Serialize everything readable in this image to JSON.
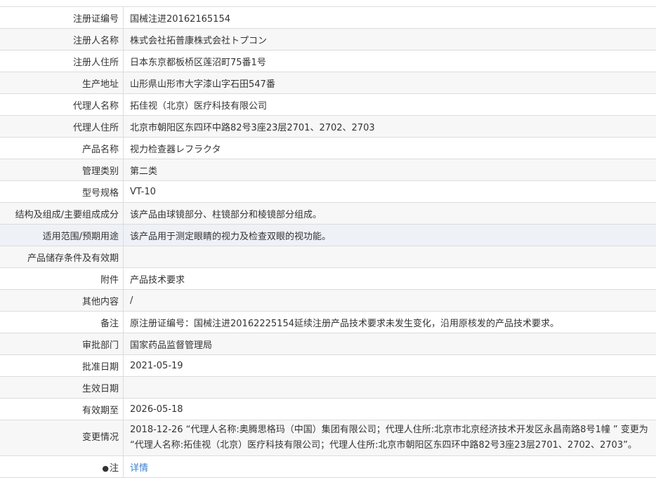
{
  "rows": [
    {
      "label": "注册证编号",
      "value": "国械注进20162165154"
    },
    {
      "label": "注册人名称",
      "value": "株式会社拓普康株式会社トプコン"
    },
    {
      "label": "注册人住所",
      "value": "日本东京都板桥区莲沼町75番1号"
    },
    {
      "label": "生产地址",
      "value": "山形県山形市大字漆山字石田547番"
    },
    {
      "label": "代理人名称",
      "value": "拓佳视（北京）医疗科技有限公司"
    },
    {
      "label": "代理人住所",
      "value": "北京市朝阳区东四环中路82号3座23层2701、2702、2703"
    },
    {
      "label": "产品名称",
      "value": "视力检查器レフラクタ"
    },
    {
      "label": "管理类别",
      "value": "第二类"
    },
    {
      "label": "型号规格",
      "value": "VT-10"
    },
    {
      "label": "结构及组成/主要组成成分",
      "value": "该产品由球镜部分、柱镜部分和棱镜部分组成。"
    },
    {
      "label": "适用范围/预期用途",
      "value": "该产品用于测定眼睛的视力及检查双眼的视功能。"
    },
    {
      "label": "产品储存条件及有效期",
      "value": ""
    },
    {
      "label": "附件",
      "value": "产品技术要求"
    },
    {
      "label": "其他内容",
      "value": "/"
    },
    {
      "label": "备注",
      "value": "原注册证编号：国械注进20162225154延续注册产品技术要求未发生变化，沿用原核发的产品技术要求。"
    },
    {
      "label": "审批部门",
      "value": "国家药品监督管理局"
    },
    {
      "label": "批准日期",
      "value": "2021-05-19"
    },
    {
      "label": "生效日期",
      "value": ""
    },
    {
      "label": "有效期至",
      "value": "2026-05-18"
    },
    {
      "label": "变更情况",
      "value": "2018-12-26 “代理人名称:奥腾思格玛（中国）集团有限公司；代理人住所:北京市北京经济技术开发区永昌南路8号1幢 ” 变更为 “代理人名称:拓佳视（北京）医疗科技有限公司；代理人住所:北京市朝阳区东四环中路82号3座23层2701、2702、2703”。"
    }
  ],
  "note_row": {
    "pin_icon": "pin-icon",
    "label": "注",
    "link_text": "详情"
  }
}
